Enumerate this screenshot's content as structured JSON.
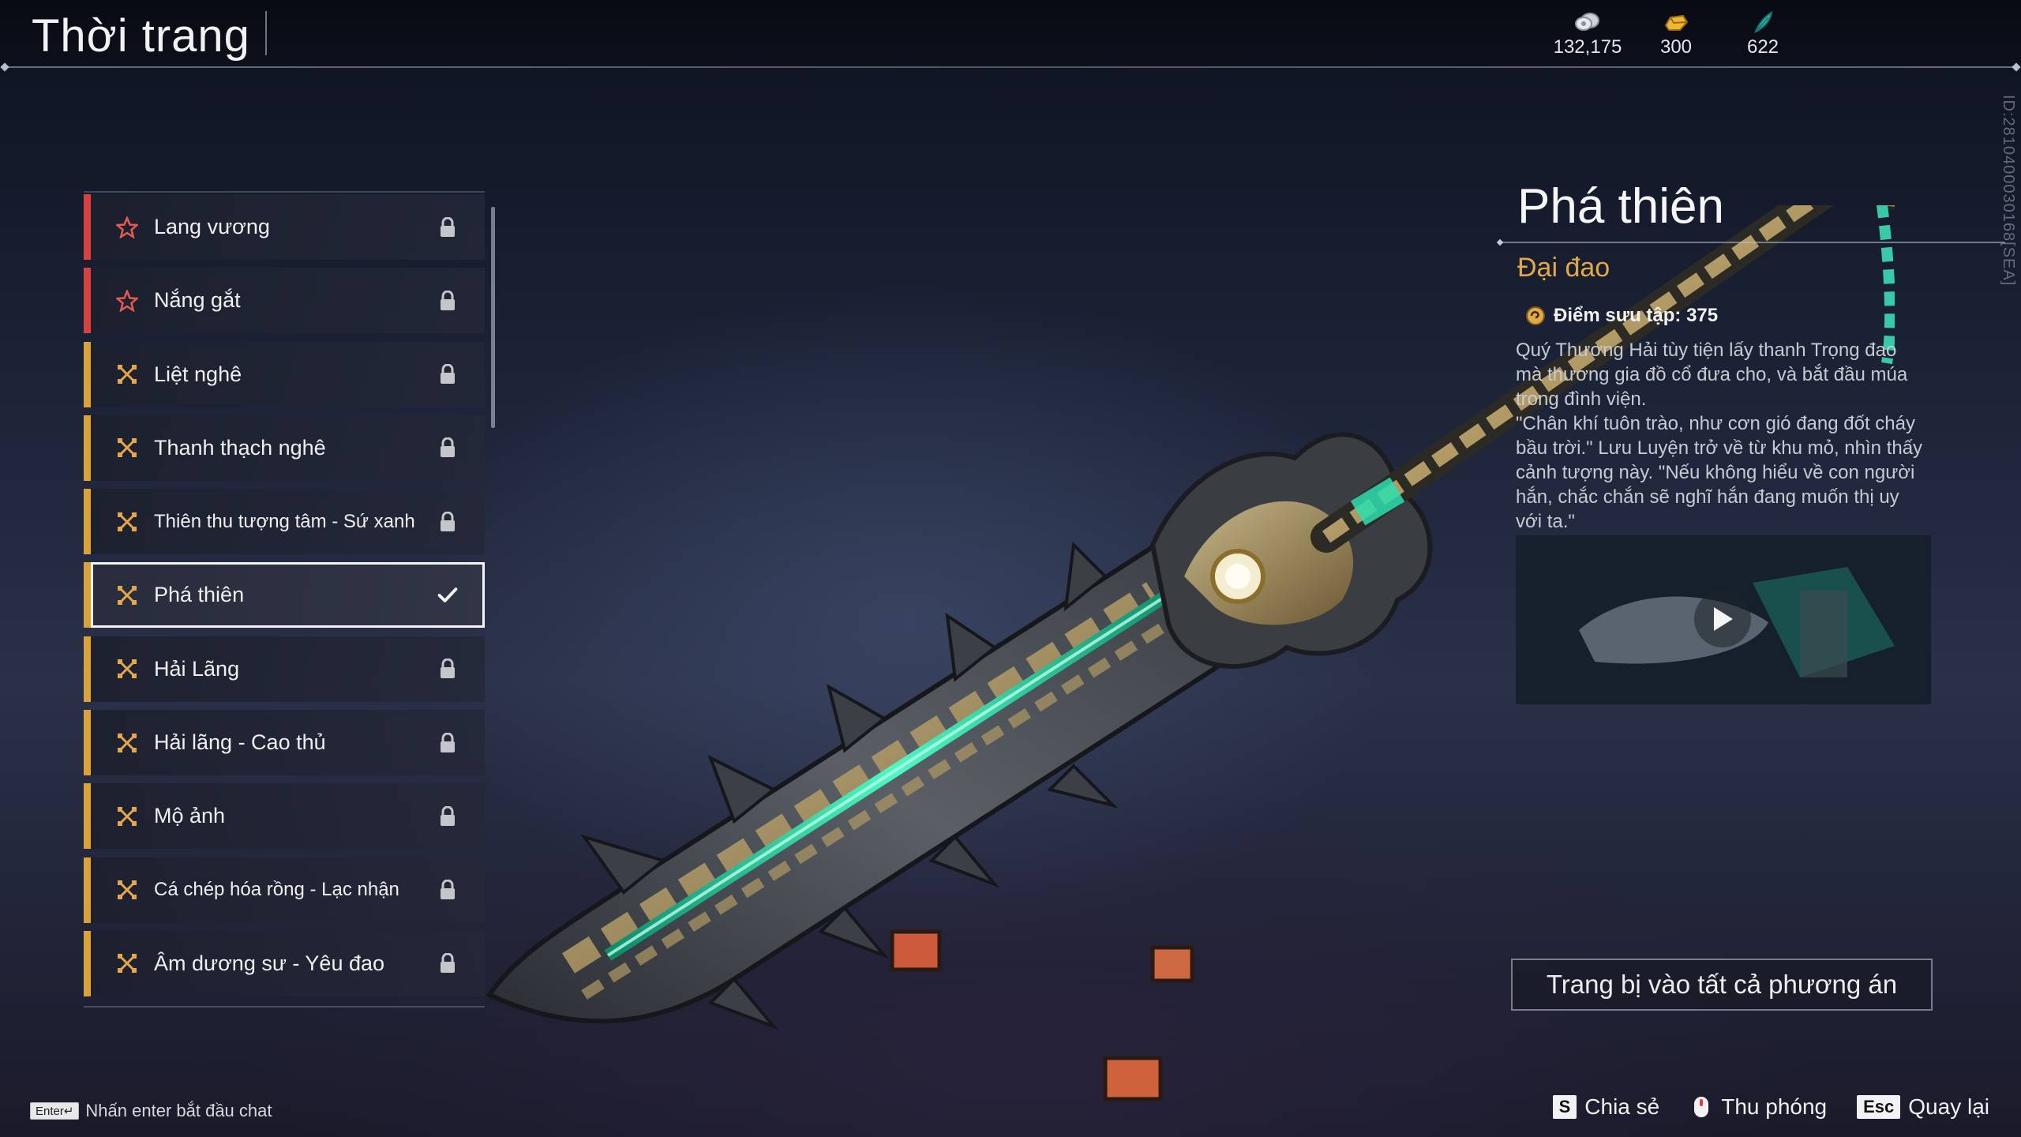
{
  "header": {
    "title": "Thời trang",
    "currencies": [
      {
        "icon": "silver-coin-icon",
        "value": "132,175"
      },
      {
        "icon": "gold-ingot-icon",
        "value": "300"
      },
      {
        "icon": "jade-feather-icon",
        "value": "622"
      }
    ]
  },
  "side_id": "ID:2810400030168[SEA]",
  "outfits": [
    {
      "label": "Lang vương",
      "rarity": "red",
      "status": "locked"
    },
    {
      "label": "Nắng gắt",
      "rarity": "red",
      "status": "locked"
    },
    {
      "label": "Liệt nghê",
      "rarity": "gold",
      "status": "locked"
    },
    {
      "label": "Thanh thạch nghê",
      "rarity": "gold",
      "status": "locked"
    },
    {
      "label": "Thiên thu tượng tâm - Sứ xanh",
      "rarity": "gold",
      "status": "locked"
    },
    {
      "label": "Phá thiên",
      "rarity": "gold",
      "status": "equipped"
    },
    {
      "label": "Hải Lãng",
      "rarity": "gold",
      "status": "locked"
    },
    {
      "label": "Hải lãng - Cao thủ",
      "rarity": "gold",
      "status": "locked"
    },
    {
      "label": "Mộ ảnh",
      "rarity": "gold",
      "status": "locked"
    },
    {
      "label": "Cá chép hóa rồng - Lạc nhận",
      "rarity": "gold",
      "status": "locked"
    },
    {
      "label": "Âm dương sư - Yêu đao",
      "rarity": "gold",
      "status": "locked"
    }
  ],
  "detail": {
    "name": "Phá thiên",
    "type": "Đại đao",
    "points": "Điểm sưu tập: 375",
    "description": [
      "Quý Thương Hải tùy tiện lấy thanh Trọng đao mà thương gia đồ cổ đưa cho, và bắt đầu múa trong đình viện.",
      "\"Chân khí tuôn trào, như cơn gió đang đốt cháy bầu trời.\" Lưu Luyện trở về từ khu mỏ, nhìn thấy cảnh tượng này. \"Nếu không hiểu về con người hắn, chắc chắn sẽ nghĩ hắn đang muốn thị uy với ta.\""
    ],
    "equip_all_label": "Trang bị vào tất cả phương án"
  },
  "footer": {
    "enter_key": "Enter↵",
    "chat_hint": "Nhấn enter bắt đầu chat",
    "share_key": "S",
    "share_label": "Chia sẻ",
    "zoom_label": "Thu phóng",
    "back_key": "Esc",
    "back_label": "Quay lại"
  },
  "colors": {
    "rarity_red": "#d8423e",
    "rarity_gold": "#d9a33a",
    "type_text": "#e2a94a",
    "jade": "#2ee0b0"
  }
}
